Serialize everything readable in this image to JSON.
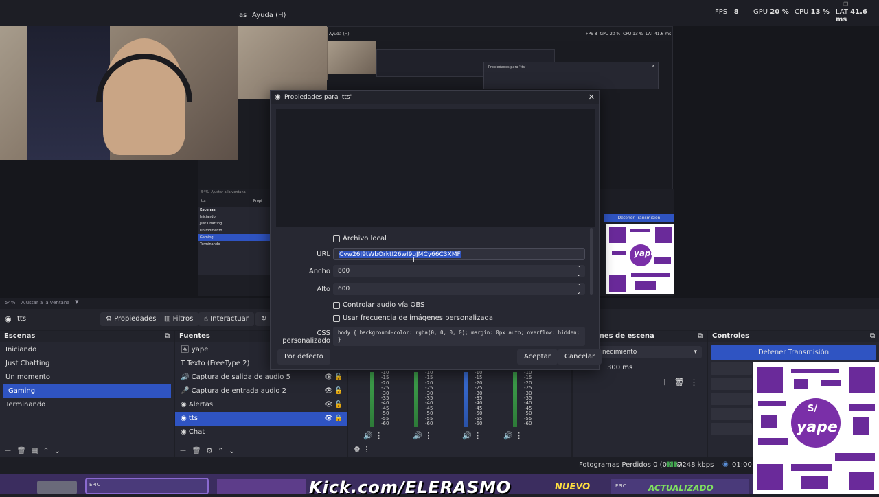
{
  "menu": {
    "partial": "as",
    "help": "Ayuda (H)"
  },
  "stats": {
    "fps_label": "FPS",
    "fps": "8",
    "gpu_label": "GPU",
    "gpu": "20 %",
    "cpu_label": "CPU",
    "cpu": "13 %",
    "lat_label": "LAT",
    "lat": "41.6 ms"
  },
  "nested": {
    "help": "Ayuda (H)",
    "fps": "FPS 8",
    "gpu": "GPU 20 %",
    "cpu": "CPU 13 %",
    "lat": "LAT 41.6 ms",
    "dialog_title": "Propiedades para 'tts'",
    "zoom": "54%",
    "fit": "Ajustar a la ventana",
    "source": "tts",
    "props": "Propi",
    "scenes_title": "Escenas",
    "scenes": [
      "Iniciando",
      "Just Chatting",
      "Un momento",
      "Gaming",
      "Terminando"
    ],
    "stop": "Detener Transmisión"
  },
  "zoom": {
    "value": "54%",
    "fit": "Ajustar a la ventana"
  },
  "toolbar": {
    "source_name": "tts",
    "properties": "Propiedades",
    "filters": "Filtros",
    "interact": "Interactuar"
  },
  "scenes": {
    "title": "Escenas",
    "items": [
      "Iniciando",
      "Just Chatting",
      "Un momento",
      "Gaming",
      "Terminando"
    ],
    "selected": 3
  },
  "sources": {
    "title": "Fuentes",
    "items": [
      "yape",
      "Texto (FreeType 2)",
      "Captura de salida de audio 5",
      "Captura de entrada audio 2",
      "Alertas",
      "tts",
      "Chat"
    ]
  },
  "transitions": {
    "title": "nsiciones de escena",
    "current": "necimiento",
    "duration": "300 ms"
  },
  "controls": {
    "title": "Controles",
    "stop_stream": "Detener Transmisión"
  },
  "mixer_ticks": [
    "-10",
    "-15",
    "-20",
    "-25",
    "-30",
    "-35",
    "-40",
    "-45",
    "-50",
    "-55",
    "-60"
  ],
  "dialog": {
    "title": "Propiedades para 'tts'",
    "local_file": "Archivo local",
    "url_label": "URL",
    "url_value": "Cvw26J9tWbOrktI26wI9gJMCy66C3XMF",
    "width_label": "Ancho",
    "width_value": "800",
    "height_label": "Alto",
    "height_value": "600",
    "audio_control": "Controlar audio vía OBS",
    "custom_fps": "Usar frecuencia de imágenes personalizada",
    "css_label": "CSS personalizado",
    "css_value": "body { background-color: rgba(0, 0, 0, 0); margin: 0px auto; overflow: hidden; }",
    "defaults": "Por defecto",
    "accept": "Aceptar",
    "cancel": "Cancelar"
  },
  "status": {
    "dropped": "Fotogramas Perdidos 0 (0.0%)",
    "bitrate": "7248 kbps",
    "time": "01:00:05"
  },
  "banner": {
    "kick": "Kick.com/ELERASMO",
    "nuevo": "NUEVO",
    "actualizado": "ACTUALIZADO",
    "epic": "EPIC"
  },
  "qr": {
    "brand": "yape",
    "symbol": "S/"
  },
  "colors": {
    "accent": "#2f54c2",
    "dialog_bg": "#272832",
    "qr_purple": "#6a2a9a",
    "meter_green": "#3fa34d"
  }
}
